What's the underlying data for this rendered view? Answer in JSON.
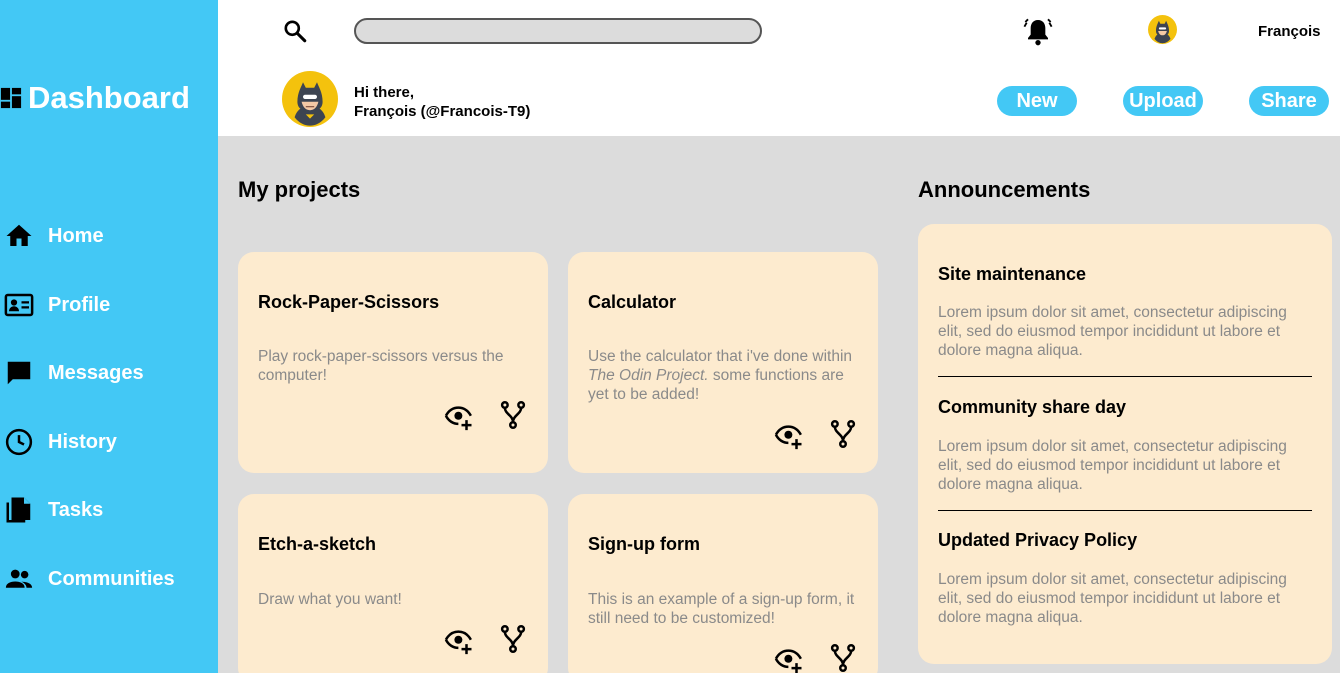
{
  "sidebar": {
    "brand": "Dashboard",
    "items": [
      {
        "label": "Home",
        "icon": "home-icon"
      },
      {
        "label": "Profile",
        "icon": "id-card-icon"
      },
      {
        "label": "Messages",
        "icon": "chat-icon"
      },
      {
        "label": "History",
        "icon": "clock-icon"
      },
      {
        "label": "Tasks",
        "icon": "documents-icon"
      },
      {
        "label": "Communities",
        "icon": "people-icon"
      }
    ]
  },
  "header": {
    "search_value": "",
    "username": "François",
    "greeting_line1": "Hi there,",
    "greeting_line2": "François (@Francois-T9)",
    "buttons": {
      "new": "New",
      "upload": "Upload",
      "share": "Share"
    }
  },
  "projects": {
    "title": "My projects",
    "cards": [
      {
        "title": "Rock-Paper-Scissors",
        "desc_pre": "Play rock-paper-scissors versus the computer!",
        "desc_em": "",
        "desc_post": ""
      },
      {
        "title": "Calculator",
        "desc_pre": "Use the calculator that i've done within ",
        "desc_em": "The Odin Project.",
        "desc_post": " some functions are yet to be added!"
      },
      {
        "title": "Etch-a-sketch",
        "desc_pre": "Draw what you want!",
        "desc_em": "",
        "desc_post": ""
      },
      {
        "title": "Sign-up form",
        "desc_pre": "This is an example of a sign-up form, it still need to be customized!",
        "desc_em": "",
        "desc_post": ""
      }
    ]
  },
  "announcements": {
    "title": "Announcements",
    "items": [
      {
        "title": "Site maintenance",
        "body": "Lorem ipsum dolor sit amet, consectetur adipiscing elit, sed do eiusmod tempor incididunt ut labore et dolore magna aliqua."
      },
      {
        "title": "Community share day",
        "body": "Lorem ipsum dolor sit amet, consectetur adipiscing elit, sed do eiusmod tempor incididunt ut labore et dolore magna aliqua."
      },
      {
        "title": "Updated Privacy Policy",
        "body": "Lorem ipsum dolor sit amet, consectetur adipiscing elit, sed do eiusmod tempor incididunt ut labore et dolore magna aliqua."
      }
    ]
  },
  "colors": {
    "accent": "#43c8f5",
    "card": "#fdebcf",
    "background": "#dcdcdc"
  }
}
